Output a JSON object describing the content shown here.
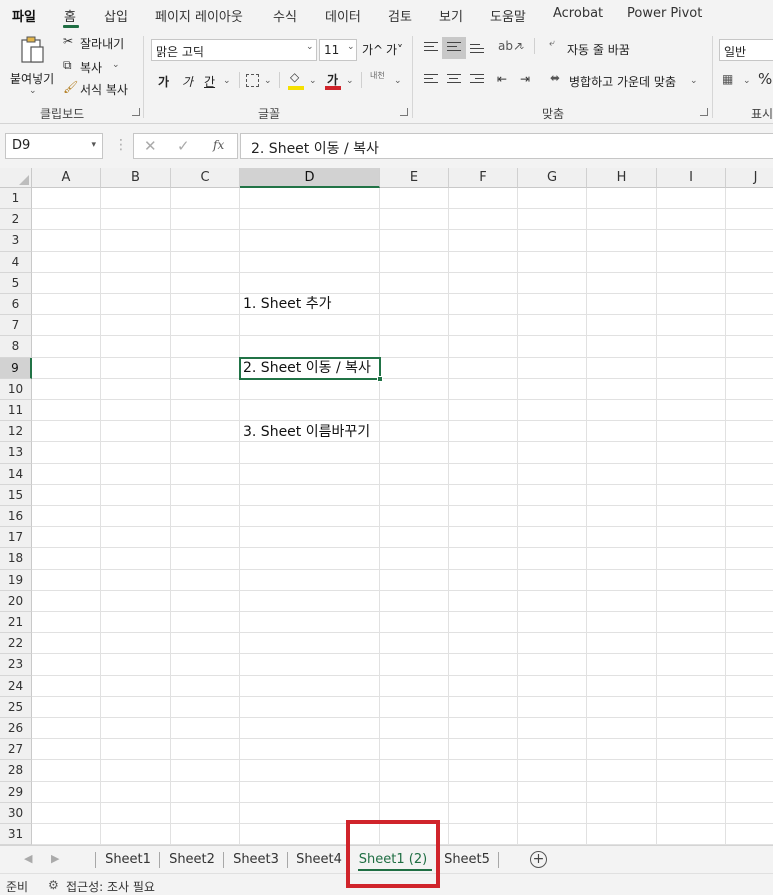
{
  "menu": {
    "tabs": [
      "파일",
      "홈",
      "삽입",
      "페이지 레이아웃",
      "수식",
      "데이터",
      "검토",
      "보기",
      "도움말",
      "Acrobat",
      "Power Pivot"
    ],
    "active": "홈"
  },
  "ribbon": {
    "clipboard": {
      "paste": "붙여넣기",
      "cut": "잘라내기",
      "copy": "복사",
      "format_painter": "서식 복사",
      "label": "클립보드"
    },
    "font": {
      "font_name": "맑은 고딕",
      "font_size": "11",
      "increase": "가^",
      "decrease": "가˅",
      "bold": "가",
      "italic": "가",
      "underline": "간",
      "font_color_glyph": "가",
      "phonetic": "내천",
      "label": "글꼴"
    },
    "alignment": {
      "wrap_text": "자동 줄 바꿈",
      "merge_center": "병합하고 가운데 맞춤",
      "label": "맞춤"
    },
    "number": {
      "format": "일반",
      "label": "표시"
    },
    "colors": {
      "fill": "#f5e000",
      "font_color": "#d0242b"
    }
  },
  "formula_bar": {
    "name_box": "D9",
    "fx": "fx",
    "content": "2. Sheet 이동 / 복사"
  },
  "grid": {
    "columns": [
      "A",
      "B",
      "C",
      "D",
      "E",
      "F",
      "G",
      "H",
      "I",
      "J"
    ],
    "rows": [
      "1",
      "2",
      "3",
      "4",
      "5",
      "6",
      "7",
      "8",
      "9",
      "10",
      "11",
      "12",
      "13",
      "14",
      "15",
      "16",
      "17",
      "18",
      "19",
      "20",
      "21",
      "22",
      "23",
      "24",
      "25",
      "26",
      "27",
      "28",
      "29",
      "30",
      "31"
    ],
    "selected_column": "D",
    "selected_row": "9",
    "cells": {
      "D6": "1. Sheet 추가",
      "D9": "2. Sheet 이동 / 복사",
      "D12": "3. Sheet 이름바꾸기"
    }
  },
  "sheet_tabs": [
    "Sheet1",
    "Sheet2",
    "Sheet3",
    "Sheet4",
    "Sheet1 (2)",
    "Sheet5"
  ],
  "active_sheet": "Sheet1 (2)",
  "status_bar": {
    "ready": "준비",
    "accessibility": "접근성: 조사 필요"
  },
  "accent": "#217346",
  "highlight_color": "#d0242b"
}
